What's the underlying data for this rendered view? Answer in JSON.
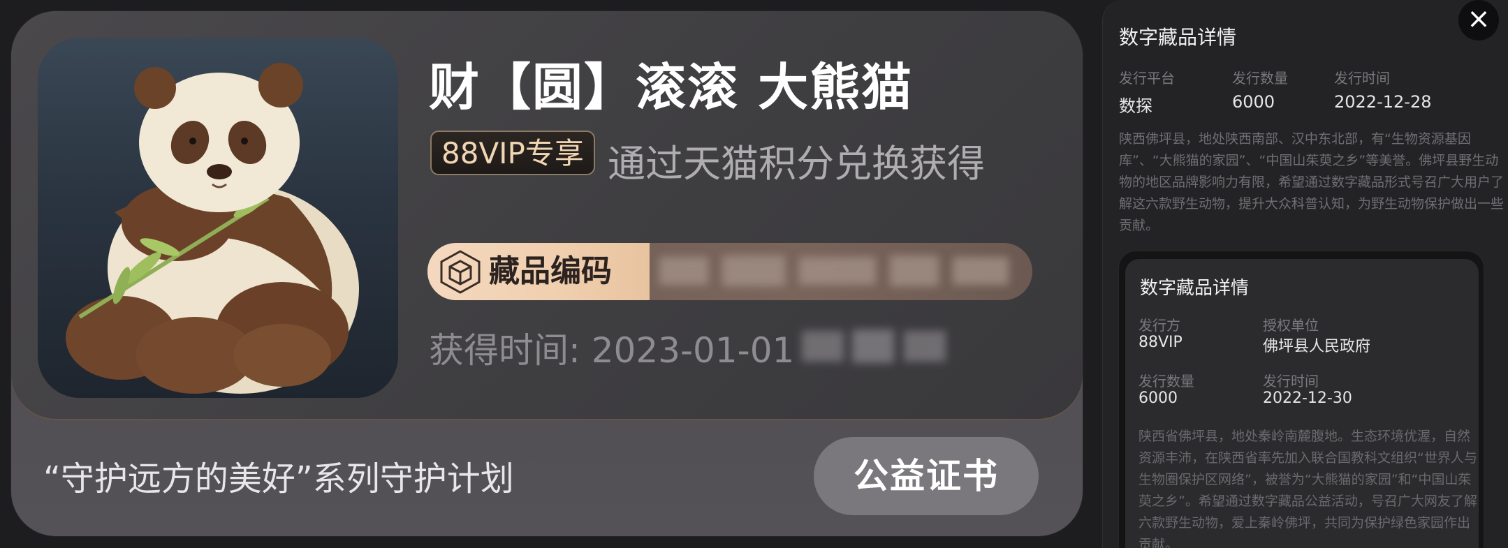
{
  "main_card": {
    "title": "财【圆】滚滚 大熊猫",
    "vip_badge": "88VIP专享",
    "subtitle": "通过天猫积分兑换获得",
    "code_label": "藏品编码",
    "acquired_time": "获得时间: 2023-01-01",
    "series_text": "“守护远方的美好”系列守护计划",
    "certificate_button": "公益证书"
  },
  "panel": {
    "title": "数字藏品详情",
    "meta": [
      {
        "label": "发行平台",
        "value": "数探"
      },
      {
        "label": "发行数量",
        "value": "6000"
      },
      {
        "label": "发行时间",
        "value": "2022-12-28"
      }
    ],
    "description": "陕西佛坪县，地处陕西南部、汉中东北部，有“生物资源基因库”、“大熊猫的家园”、“中国山茱萸之乡”等美誉。佛坪县野生动物的地区品牌影响力有限，希望通过数字藏品形式号召广大用户了解这六款野生动物，提升大众科普认知，为野生动物保护做出一些贡献。",
    "close_icon": "close-icon",
    "inner_card": {
      "title": "数字藏品详情",
      "meta": [
        {
          "label": "发行方",
          "value": "88VIP"
        },
        {
          "label": "授权单位",
          "value": "佛坪县人民政府"
        },
        {
          "label": "发行数量",
          "value": "6000"
        },
        {
          "label": "发行时间",
          "value": "2022-12-30"
        }
      ],
      "description": "陕西省佛坪县，地处秦岭南麓腹地。生态环境优渥，自然资源丰沛，在陕西省率先加入联合国教科文组织“世界人与生物圈保护区网络”，被誉为“大熊猫的家园”和“中国山茱萸之乡”。希望通过数字藏品公益活动，号召广大网友了解六款野生动物，爱上秦岭佛坪，共同为保护绿色家园作出贡献。"
    }
  },
  "icons": {
    "code": "cube-icon",
    "close": "close-icon"
  },
  "colors": {
    "card_bg": "#4a484b",
    "badge_text": "#f2d6b4",
    "code_label_bg": "#f0cfae",
    "button_bg": "#7a787c",
    "panel_bg": "#232326"
  }
}
